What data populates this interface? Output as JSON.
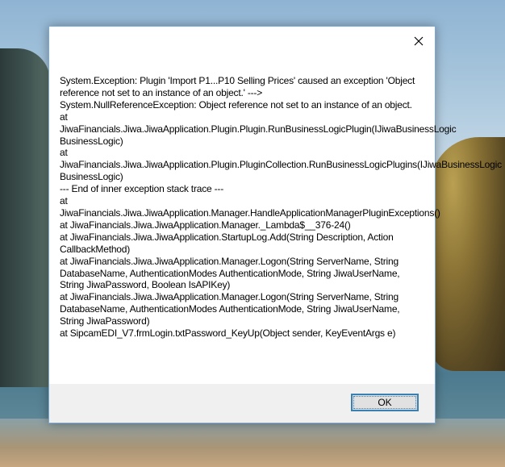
{
  "dialog": {
    "message": "System.Exception: Plugin 'Import P1...P10 Selling Prices' caused an exception 'Object reference not set to an instance of an object.' --->\nSystem.NullReferenceException: Object reference not set to an instance of an object.\n   at\nJiwaFinancials.Jiwa.JiwaApplication.Plugin.Plugin.RunBusinessLogicPlugin(IJiwaBusinessLogic BusinessLogic)\n   at\nJiwaFinancials.Jiwa.JiwaApplication.Plugin.PluginCollection.RunBusinessLogicPlugins(IJiwaBusinessLogic BusinessLogic)\n   --- End of inner exception stack trace ---\n   at\nJiwaFinancials.Jiwa.JiwaApplication.Manager.HandleApplicationManagerPluginExceptions()\n   at JiwaFinancials.Jiwa.JiwaApplication.Manager._Lambda$__376-24()\n   at JiwaFinancials.Jiwa.JiwaApplication.StartupLog.Add(String Description, Action CallbackMethod)\n   at JiwaFinancials.Jiwa.JiwaApplication.Manager.Logon(String ServerName, String DatabaseName, AuthenticationModes AuthenticationMode, String JiwaUserName, String JiwaPassword, Boolean IsAPIKey)\n   at JiwaFinancials.Jiwa.JiwaApplication.Manager.Logon(String ServerName, String DatabaseName, AuthenticationModes AuthenticationMode, String JiwaUserName, String JiwaPassword)\n   at SipcamEDI_V7.frmLogin.txtPassword_KeyUp(Object sender, KeyEventArgs e)",
    "ok_label": "OK",
    "close_icon": "close-icon"
  }
}
